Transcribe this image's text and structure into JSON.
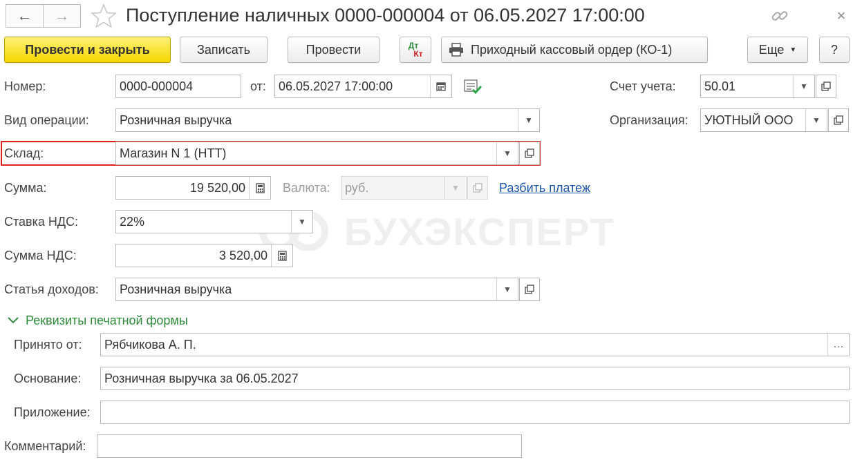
{
  "window": {
    "title": "Поступление наличных 0000-000004 от 06.05.2027 17:00:00"
  },
  "toolbar": {
    "post_close": "Провести и закрыть",
    "save": "Записать",
    "post": "Провести",
    "dtkt_top": "Дт",
    "dtkt_bottom": "Кт",
    "print_order": "Приходный кассовый ордер (КО-1)",
    "more": "Еще",
    "help": "?"
  },
  "form": {
    "number_label": "Номер:",
    "number_value": "0000-000004",
    "date_label": "от:",
    "date_value": "06.05.2027 17:00:00",
    "account_label": "Счет учета:",
    "account_value": "50.01",
    "operation_label": "Вид операции:",
    "operation_value": "Розничная выручка",
    "org_label": "Организация:",
    "org_value": "УЮТНЫЙ ООО",
    "warehouse_label": "Склад:",
    "warehouse_value": "Магазин N 1 (НТТ)",
    "sum_label": "Сумма:",
    "sum_value": "19 520,00",
    "currency_label": "Валюта:",
    "currency_value": "руб.",
    "split_link": "Разбить платеж",
    "vat_rate_label": "Ставка НДС:",
    "vat_rate_value": "22%",
    "vat_sum_label": "Сумма НДС:",
    "vat_sum_value": "3 520,00",
    "income_label": "Статья доходов:",
    "income_value": "Розничная выручка"
  },
  "print_section": {
    "title": "Реквизиты печатной формы",
    "received_label": "Принято от:",
    "received_value": "Рябчикова А. П.",
    "basis_label": "Основание:",
    "basis_value": "Розничная выручка за 06.05.2027",
    "attachment_label": "Приложение:",
    "attachment_value": ""
  },
  "comment": {
    "label": "Комментарий:",
    "value": ""
  },
  "watermark": "БУХЭКСПЕРТ",
  "colors": {
    "primary_button": "#f6d600",
    "highlight_border": "#e0201e",
    "link": "#1a55b0",
    "section": "#2e8b3a"
  }
}
